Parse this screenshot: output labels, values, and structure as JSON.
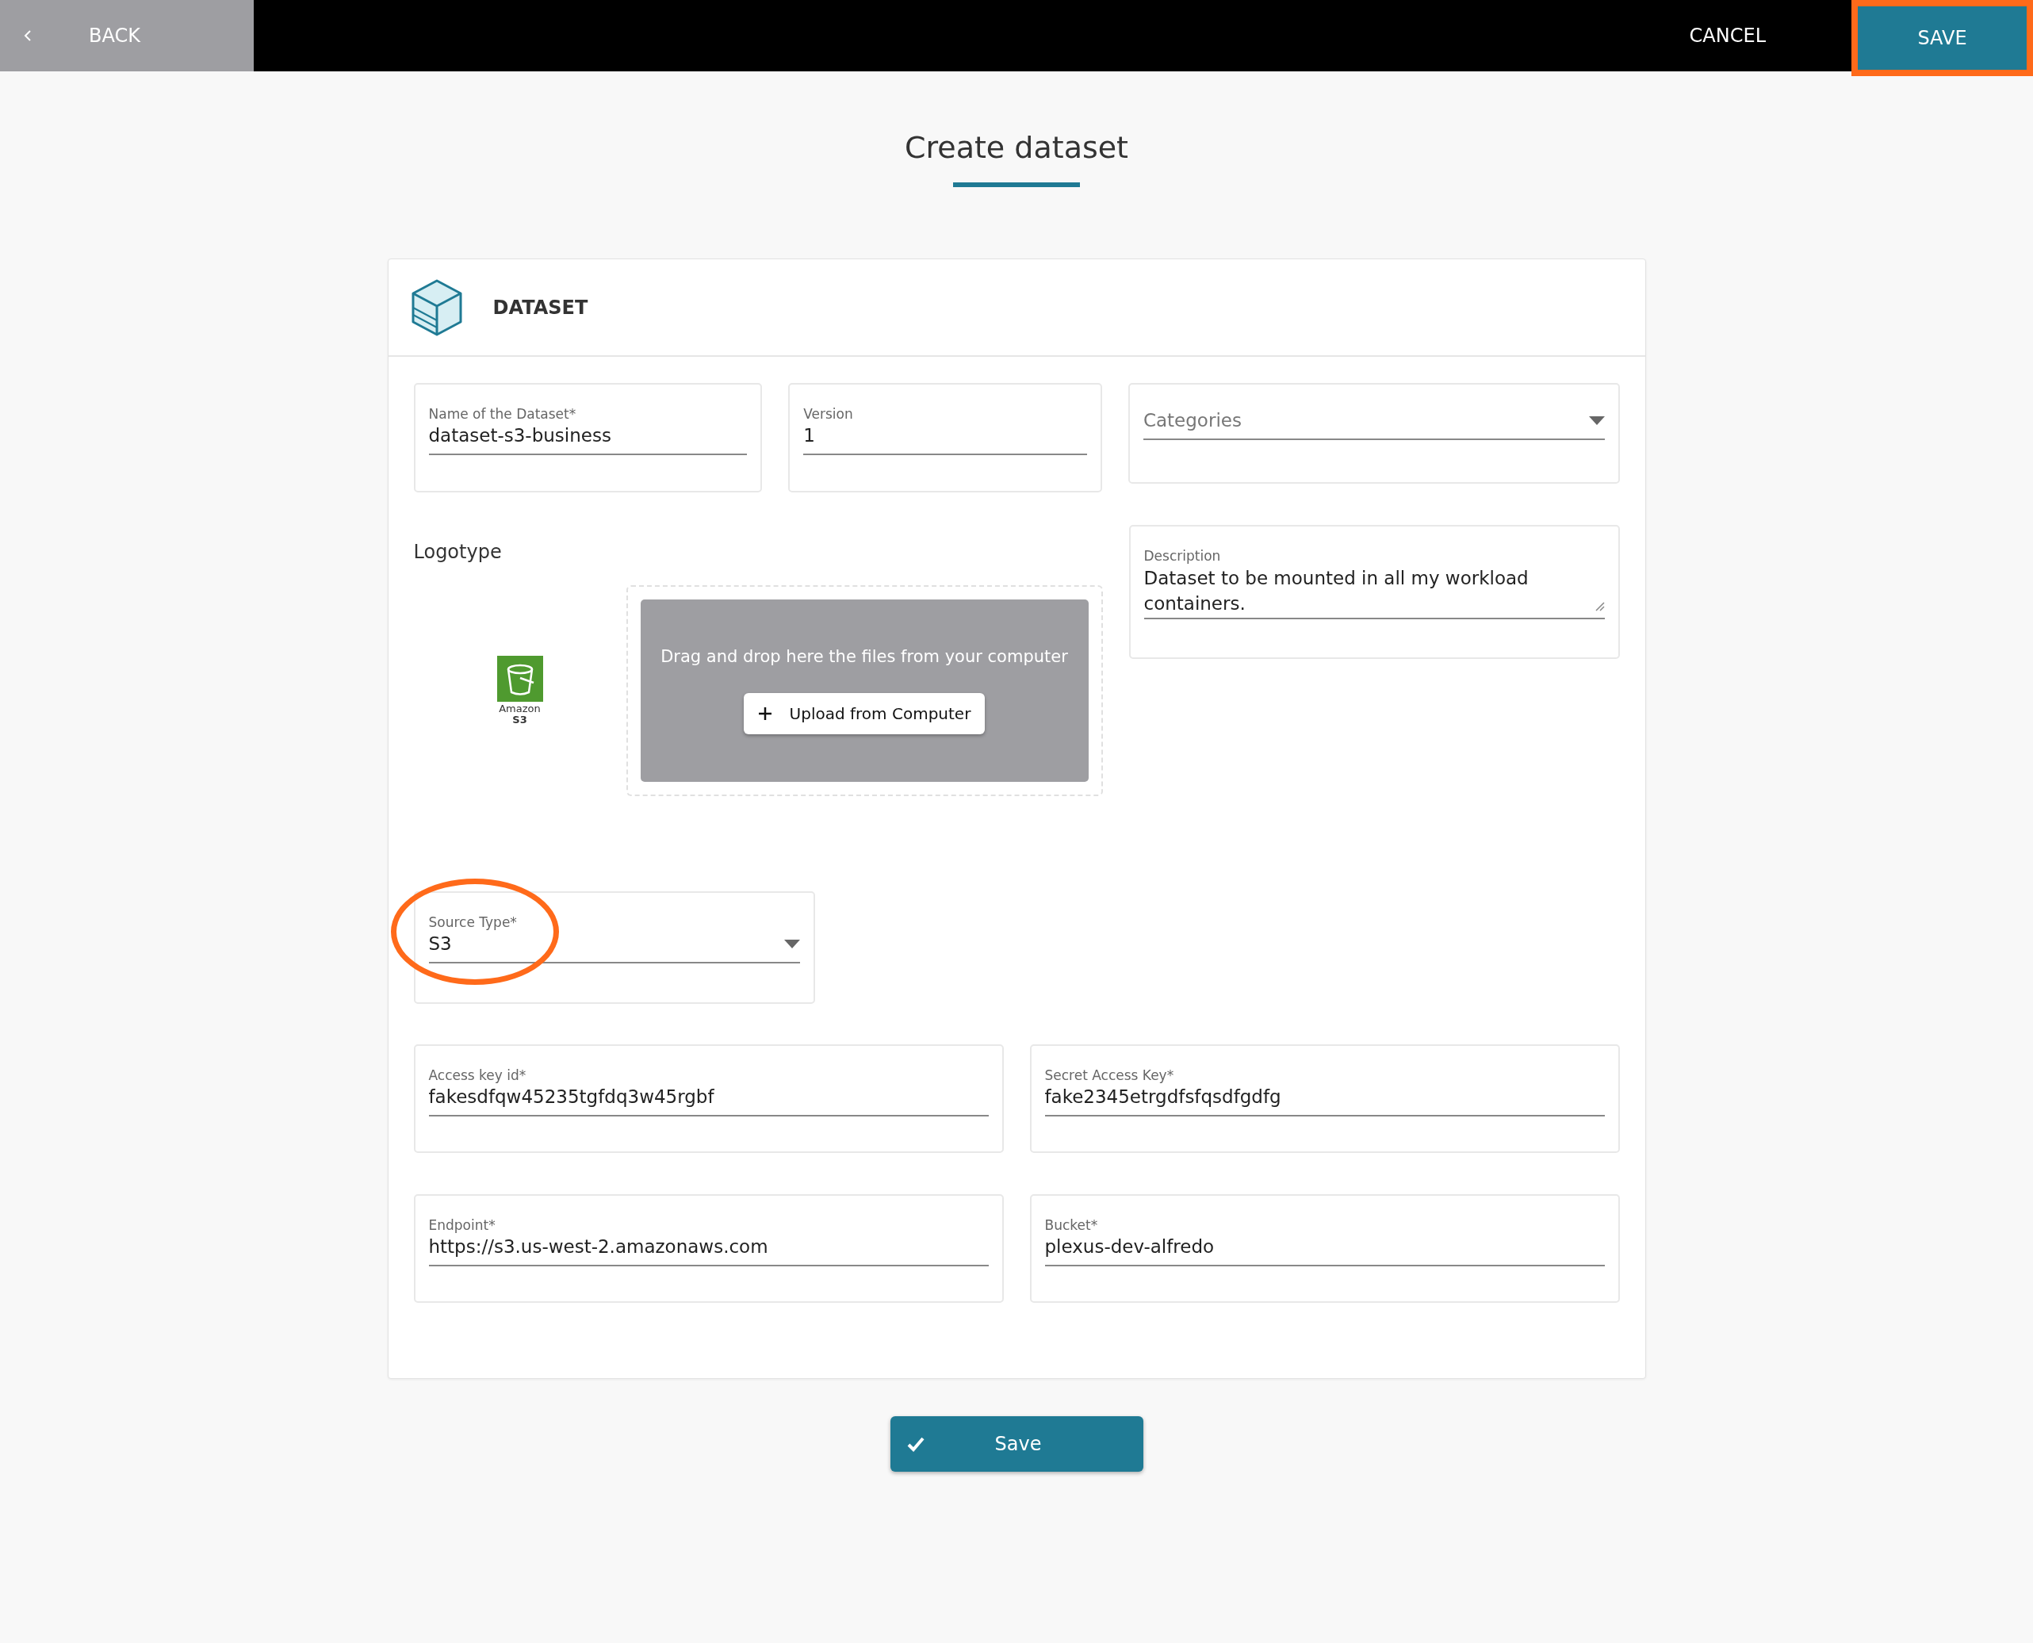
{
  "topbar": {
    "back": {
      "label": "BACK"
    },
    "cancel": {
      "label": "CANCEL"
    },
    "save": {
      "label": "SAVE",
      "highlighted": true
    }
  },
  "page_title": "Create dataset",
  "card": {
    "title": "DATASET",
    "fields_row1": [
      {
        "kind": "text",
        "label": "Name of the Dataset*",
        "value": "dataset-s3-business"
      },
      {
        "kind": "text",
        "label": "Version",
        "value": "1"
      },
      {
        "kind": "select",
        "placeholder": "Categories"
      }
    ],
    "logotype": {
      "label": "Logotype",
      "logo_caption": "Amazon",
      "logo_caption_bold": "S3",
      "dropzone_text": "Drag and drop here the files from your computer",
      "upload_button": "Upload from Computer"
    },
    "description": {
      "label": "Description",
      "value": "Dataset to be mounted in all my workload containers."
    },
    "source_type": {
      "label": "Source Type*",
      "value": "S3",
      "highlighted": true
    },
    "credentials": [
      {
        "label": "Access key id*",
        "value": "fakesdfqw45235tgfdq3w45rgbf"
      },
      {
        "label": "Secret Access Key*",
        "value": "fake2345etrgdfsfqsdfgdfg"
      },
      {
        "label": "Endpoint*",
        "value": "https://s3.us-west-2.amazonaws.com"
      },
      {
        "label": "Bucket*",
        "value": "plexus-dev-alfredo"
      }
    ]
  },
  "save_button": {
    "label": "Save"
  }
}
